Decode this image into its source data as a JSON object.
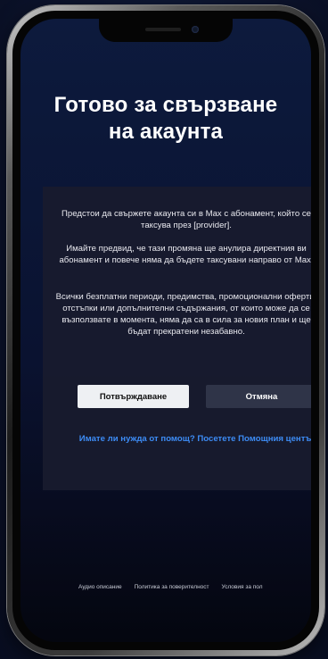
{
  "dialog": {
    "title": "Готово за свързване на акаунта",
    "message_1": "Предстои да свържете акаунта си в Max с абонамент, който се таксува през [provider].",
    "message_2": "Имайте предвид, че тази промяна ще анулира директния ви абонамент и повече няма да бъдете таксувани направо от Max.",
    "message_3": "Всички безплатни периоди, предимства, промоционални оферти, отстъпки или допълнителни съдържания, от които може да се възползвате в момента, няма да са в сила за новия план и ще бъдат прекратени незабавно.",
    "confirm_label": "Потвърждаване",
    "cancel_label": "Отмяна",
    "help_text": "Имате ли нужда от помощ? Посетете Помощния център"
  },
  "footer": {
    "links": [
      "Аудио описание",
      "Политика за поверителност",
      "Условия за пол"
    ]
  },
  "colors": {
    "background": "#0d1a3d",
    "card": "#181b2e",
    "confirm_button": "#eef0f3",
    "cancel_button": "#2f3448",
    "help_link": "#3d8cf5"
  },
  "icons": [
    "external-link-icon"
  ]
}
